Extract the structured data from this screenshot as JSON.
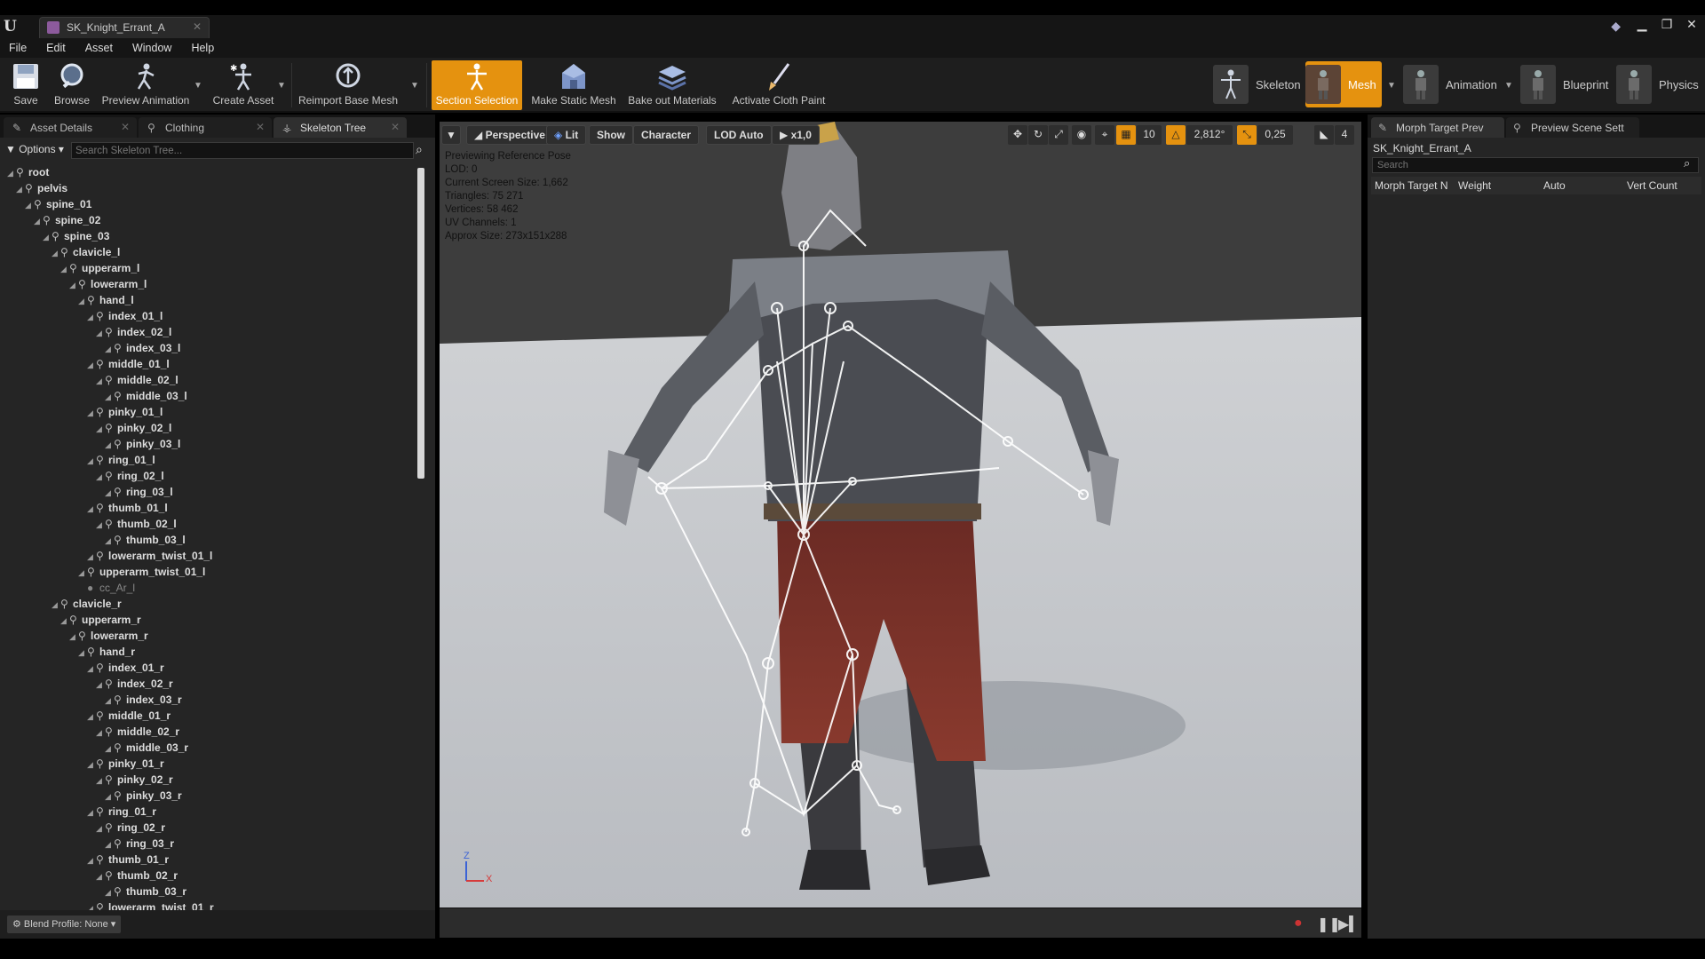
{
  "window": {
    "tab_title": "SK_Knight_Errant_A",
    "controls": [
      "▁",
      "❐",
      "✕"
    ]
  },
  "menu": [
    "File",
    "Edit",
    "Asset",
    "Window",
    "Help"
  ],
  "toolbar": {
    "save": "Save",
    "browse": "Browse",
    "preview_animation": "Preview Animation",
    "create_asset": "Create Asset",
    "reimport": "Reimport Base Mesh",
    "section_selection": "Section Selection",
    "make_static_mesh": "Make Static Mesh",
    "bake_materials": "Bake out Materials",
    "cloth_paint": "Activate Cloth Paint"
  },
  "modes": {
    "skeleton": "Skeleton",
    "mesh": "Mesh",
    "animation": "Animation",
    "blueprint": "Blueprint",
    "physics": "Physics"
  },
  "left_tabs": [
    "Asset Details",
    "Clothing",
    "Skeleton Tree"
  ],
  "skeleton_tree": {
    "options": "Options",
    "search_placeholder": "Search Skeleton Tree...",
    "rows": [
      {
        "label": "root",
        "depth": 0
      },
      {
        "label": "pelvis",
        "depth": 1
      },
      {
        "label": "spine_01",
        "depth": 2
      },
      {
        "label": "spine_02",
        "depth": 3
      },
      {
        "label": "spine_03",
        "depth": 4
      },
      {
        "label": "clavicle_l",
        "depth": 5
      },
      {
        "label": "upperarm_l",
        "depth": 6
      },
      {
        "label": "lowerarm_l",
        "depth": 7
      },
      {
        "label": "hand_l",
        "depth": 8
      },
      {
        "label": "index_01_l",
        "depth": 9
      },
      {
        "label": "index_02_l",
        "depth": 10
      },
      {
        "label": "index_03_l",
        "depth": 11
      },
      {
        "label": "middle_01_l",
        "depth": 9
      },
      {
        "label": "middle_02_l",
        "depth": 10
      },
      {
        "label": "middle_03_l",
        "depth": 11
      },
      {
        "label": "pinky_01_l",
        "depth": 9
      },
      {
        "label": "pinky_02_l",
        "depth": 10
      },
      {
        "label": "pinky_03_l",
        "depth": 11
      },
      {
        "label": "ring_01_l",
        "depth": 9
      },
      {
        "label": "ring_02_l",
        "depth": 10
      },
      {
        "label": "ring_03_l",
        "depth": 11
      },
      {
        "label": "thumb_01_l",
        "depth": 9
      },
      {
        "label": "thumb_02_l",
        "depth": 10
      },
      {
        "label": "thumb_03_l",
        "depth": 11
      },
      {
        "label": "lowerarm_twist_01_l",
        "depth": 9
      },
      {
        "label": "upperarm_twist_01_l",
        "depth": 8
      },
      {
        "label": "cc_Ar_l",
        "depth": 8,
        "socket": true
      },
      {
        "label": "clavicle_r",
        "depth": 5
      },
      {
        "label": "upperarm_r",
        "depth": 6
      },
      {
        "label": "lowerarm_r",
        "depth": 7
      },
      {
        "label": "hand_r",
        "depth": 8
      },
      {
        "label": "index_01_r",
        "depth": 9
      },
      {
        "label": "index_02_r",
        "depth": 10
      },
      {
        "label": "index_03_r",
        "depth": 11
      },
      {
        "label": "middle_01_r",
        "depth": 9
      },
      {
        "label": "middle_02_r",
        "depth": 10
      },
      {
        "label": "middle_03_r",
        "depth": 11
      },
      {
        "label": "pinky_01_r",
        "depth": 9
      },
      {
        "label": "pinky_02_r",
        "depth": 10
      },
      {
        "label": "pinky_03_r",
        "depth": 11
      },
      {
        "label": "ring_01_r",
        "depth": 9
      },
      {
        "label": "ring_02_r",
        "depth": 10
      },
      {
        "label": "ring_03_r",
        "depth": 11
      },
      {
        "label": "thumb_01_r",
        "depth": 9
      },
      {
        "label": "thumb_02_r",
        "depth": 10
      },
      {
        "label": "thumb_03_r",
        "depth": 11
      },
      {
        "label": "lowerarm_twist_01_r",
        "depth": 9
      }
    ]
  },
  "blend_profile": "Blend Profile: None",
  "viewport": {
    "buttons": {
      "perspective": "Perspective",
      "lit": "Lit",
      "show": "Show",
      "character": "Character",
      "lod": "LOD Auto",
      "speed": "x1,0"
    },
    "grid_snap": "10",
    "rot_snap": "2,812°",
    "scale_snap": "0,25",
    "cam_speed": "4",
    "info": [
      "Previewing Reference Pose",
      "LOD: 0",
      "Current Screen Size: 1,662",
      "Triangles: 75 271",
      "Vertices: 58 462",
      "UV Channels: 1",
      "Approx Size: 273x151x288"
    ],
    "axis_z": "Z",
    "axis_x": "X"
  },
  "right_tabs": [
    "Morph Target Prev",
    "Preview Scene Sett"
  ],
  "morph_panel": {
    "asset_name": "SK_Knight_Errant_A",
    "search_placeholder": "Search",
    "columns": [
      "Morph Target N",
      "Weight",
      "Auto",
      "Vert Count"
    ]
  },
  "colors": {
    "accent": "#e5920f",
    "panel": "#252525",
    "viewport_bg": "#c2c5c9"
  }
}
